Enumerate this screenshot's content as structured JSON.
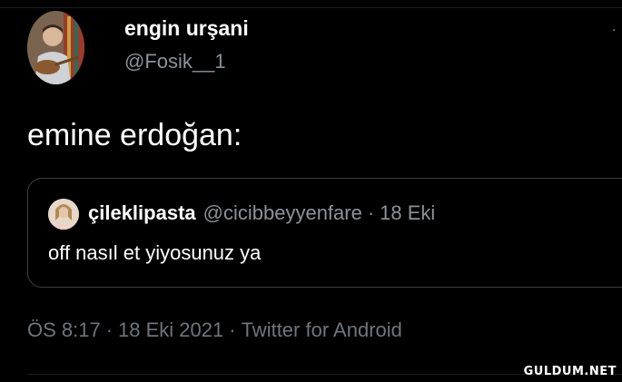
{
  "author": {
    "display_name": "engin urşani",
    "handle": "@Fosik__1",
    "avatar_icon": "user-photo-avatar"
  },
  "tweet": {
    "text": "emine erdoğan:"
  },
  "quoted_tweet": {
    "display_name": "çileklipasta",
    "handle": "@cicibbeyyenfare",
    "separator": "·",
    "date": "18 Eki",
    "text": "off nasıl et yiyosunuz ya",
    "avatar_icon": "user-photo-avatar"
  },
  "meta": {
    "time": "ÖS 8:17",
    "separator": "·",
    "date": "18 Eki 2021",
    "source": "Twitter for Android"
  },
  "watermark": "GULDUM.NET",
  "colors": {
    "background": "#000000",
    "primary_text": "#ffffff",
    "secondary_text": "#8b9299",
    "border": "#3a3f45"
  }
}
